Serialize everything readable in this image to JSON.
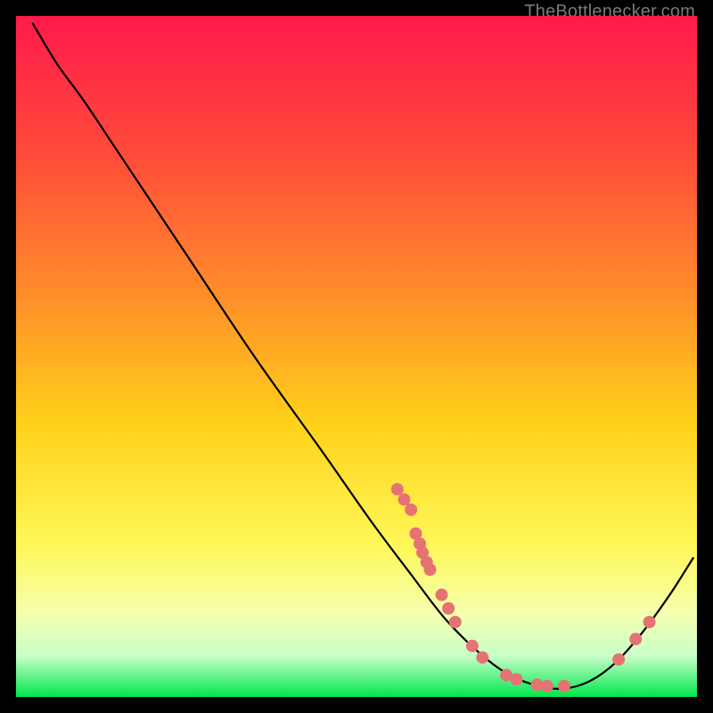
{
  "watermark": "TheBottlenecker.com",
  "chart_data": {
    "type": "line",
    "title": "",
    "xlabel": "",
    "ylabel": "",
    "xlim": [
      0,
      100
    ],
    "ylim": [
      0,
      100
    ],
    "gradient_stops": [
      {
        "offset": 0,
        "color": "#ff1a4b"
      },
      {
        "offset": 20,
        "color": "#ff4a3a"
      },
      {
        "offset": 40,
        "color": "#ff8a2a"
      },
      {
        "offset": 60,
        "color": "#ffd21a"
      },
      {
        "offset": 78,
        "color": "#fff85a"
      },
      {
        "offset": 88,
        "color": "#f4ffb0"
      },
      {
        "offset": 94,
        "color": "#c8ffc8"
      },
      {
        "offset": 100,
        "color": "#00e64d"
      }
    ],
    "curve": [
      {
        "x": 2.4,
        "y": 99.0
      },
      {
        "x": 6.0,
        "y": 93.0
      },
      {
        "x": 10.0,
        "y": 87.5
      },
      {
        "x": 15.0,
        "y": 80.0
      },
      {
        "x": 25.0,
        "y": 65.0
      },
      {
        "x": 35.0,
        "y": 50.0
      },
      {
        "x": 45.0,
        "y": 36.0
      },
      {
        "x": 52.0,
        "y": 26.0
      },
      {
        "x": 58.0,
        "y": 18.0
      },
      {
        "x": 63.0,
        "y": 11.5
      },
      {
        "x": 68.0,
        "y": 6.5
      },
      {
        "x": 72.0,
        "y": 3.5
      },
      {
        "x": 76.0,
        "y": 1.8
      },
      {
        "x": 80.0,
        "y": 1.2
      },
      {
        "x": 84.0,
        "y": 2.2
      },
      {
        "x": 88.0,
        "y": 5.0
      },
      {
        "x": 92.0,
        "y": 9.5
      },
      {
        "x": 96.0,
        "y": 15.0
      },
      {
        "x": 99.5,
        "y": 20.5
      }
    ],
    "markers": [
      {
        "x": 56.0,
        "y": 30.5
      },
      {
        "x": 57.0,
        "y": 29.0
      },
      {
        "x": 58.0,
        "y": 27.5
      },
      {
        "x": 58.7,
        "y": 24.0
      },
      {
        "x": 59.3,
        "y": 22.5
      },
      {
        "x": 59.7,
        "y": 21.2
      },
      {
        "x": 60.3,
        "y": 19.8
      },
      {
        "x": 60.8,
        "y": 18.7
      },
      {
        "x": 62.5,
        "y": 15.0
      },
      {
        "x": 63.5,
        "y": 13.0
      },
      {
        "x": 64.5,
        "y": 11.0
      },
      {
        "x": 67.0,
        "y": 7.5
      },
      {
        "x": 68.5,
        "y": 5.8
      },
      {
        "x": 72.0,
        "y": 3.2
      },
      {
        "x": 73.5,
        "y": 2.6
      },
      {
        "x": 76.5,
        "y": 1.8
      },
      {
        "x": 78.0,
        "y": 1.6
      },
      {
        "x": 80.5,
        "y": 1.6
      },
      {
        "x": 88.5,
        "y": 5.5
      },
      {
        "x": 91.0,
        "y": 8.5
      },
      {
        "x": 93.0,
        "y": 11.0
      }
    ],
    "marker_color": "#e57373",
    "curve_color": "#000000"
  }
}
